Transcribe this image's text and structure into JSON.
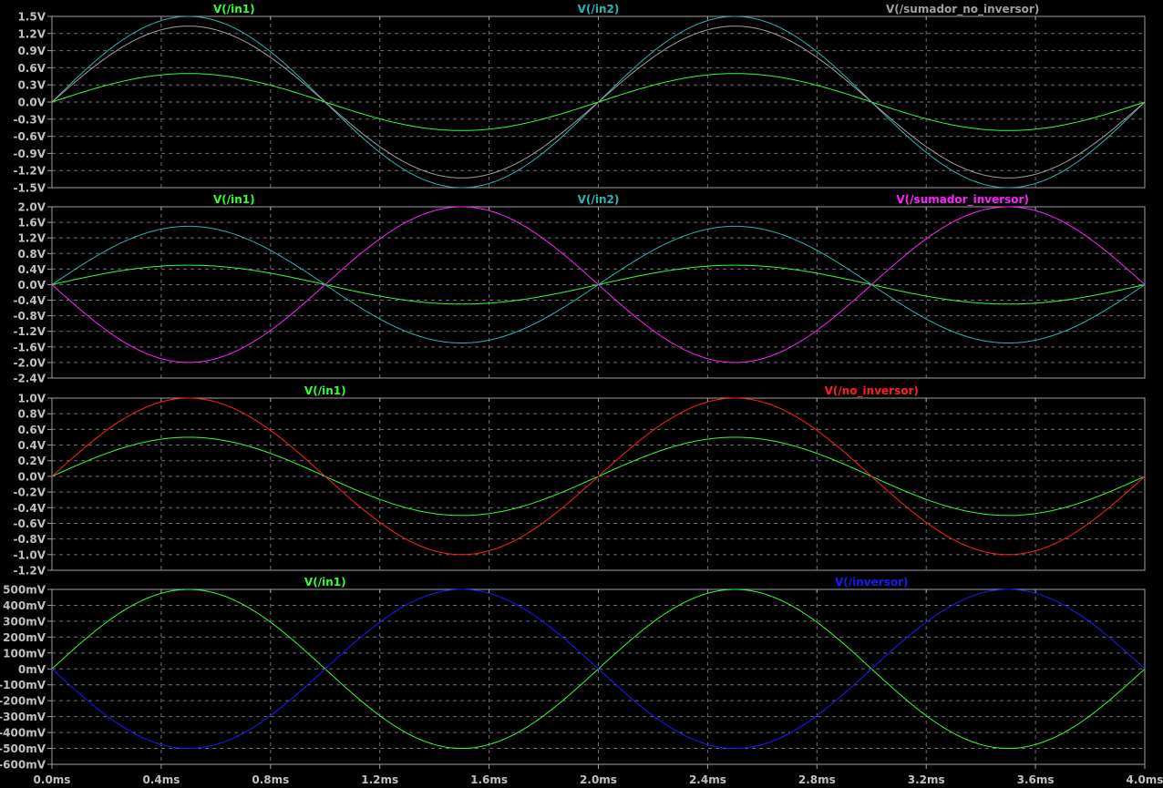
{
  "x_axis": {
    "unit": "ms",
    "range": [
      0,
      4.0
    ],
    "ticks": [
      "0.0ms",
      "0.4ms",
      "0.8ms",
      "1.2ms",
      "1.6ms",
      "2.0ms",
      "2.4ms",
      "2.8ms",
      "3.2ms",
      "3.6ms",
      "4.0ms"
    ]
  },
  "colors": {
    "background": "#000000",
    "axis": "#a0a0a0",
    "grid": "#707070",
    "text": "#c0c0c0"
  },
  "chart_data": [
    {
      "type": "line",
      "ylim": [
        -1.5,
        1.5
      ],
      "yticks": [
        "1.5V",
        "1.2V",
        "0.9V",
        "0.6V",
        "0.3V",
        "0.0V",
        "-0.3V",
        "-0.6V",
        "-0.9V",
        "-1.2V",
        "-1.5V"
      ],
      "series": [
        {
          "name": "V(/in1)",
          "color": "#33ff33",
          "amplitude_V": 0.5,
          "frequency_Hz": 500
        },
        {
          "name": "V(/in2)",
          "color": "#2ab5b5",
          "amplitude_V": 1.5,
          "frequency_Hz": 500
        },
        {
          "name": "V(/sumador_no_inversor)",
          "color": "#a0a0a0",
          "amplitude_V": 1.33,
          "frequency_Hz": 500
        }
      ]
    },
    {
      "type": "line",
      "ylim": [
        -2.4,
        2.0
      ],
      "yticks": [
        "2.0V",
        "1.6V",
        "1.2V",
        "0.8V",
        "0.4V",
        "0.0V",
        "-0.4V",
        "-0.8V",
        "-1.2V",
        "-1.6V",
        "-2.0V",
        "-2.4V"
      ],
      "series": [
        {
          "name": "V(/in1)",
          "color": "#33ff33",
          "amplitude_V": 0.5,
          "frequency_Hz": 500
        },
        {
          "name": "V(/in2)",
          "color": "#2ab5b5",
          "amplitude_V": 1.5,
          "frequency_Hz": 500
        },
        {
          "name": "V(/sumador_inversor)",
          "color": "#ff22ff",
          "amplitude_V": -2.0,
          "frequency_Hz": 500
        }
      ]
    },
    {
      "type": "line",
      "ylim": [
        -1.2,
        1.0
      ],
      "yticks": [
        "1.0V",
        "0.8V",
        "0.6V",
        "0.4V",
        "0.2V",
        "0.0V",
        "-0.2V",
        "-0.4V",
        "-0.6V",
        "-0.8V",
        "-1.0V",
        "-1.2V"
      ],
      "series": [
        {
          "name": "V(/in1)",
          "color": "#33ff33",
          "amplitude_V": 0.5,
          "frequency_Hz": 500
        },
        {
          "name": "V(/no_inversor)",
          "color": "#ff2020",
          "amplitude_V": 1.0,
          "frequency_Hz": 500
        }
      ]
    },
    {
      "type": "line",
      "ylim": [
        -0.6,
        0.5
      ],
      "yticks": [
        "500mV",
        "400mV",
        "300mV",
        "200mV",
        "100mV",
        "0mV",
        "-100mV",
        "-200mV",
        "-300mV",
        "-400mV",
        "-500mV",
        "-600mV"
      ],
      "series": [
        {
          "name": "V(/in1)",
          "color": "#33ff33",
          "amplitude_V": 0.5,
          "frequency_Hz": 500
        },
        {
          "name": "V(/inversor)",
          "color": "#1a1aff",
          "amplitude_V": -0.5,
          "frequency_Hz": 500
        }
      ]
    }
  ]
}
